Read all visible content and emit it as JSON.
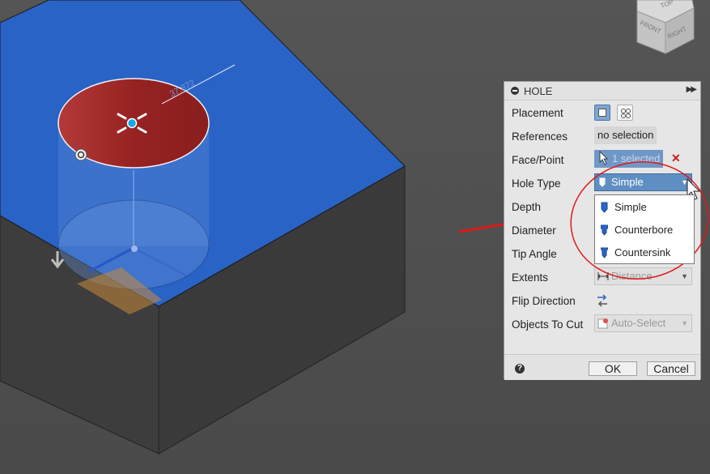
{
  "viewport": {
    "dimension_text": "37.872",
    "viewcube": {
      "top": "TOP",
      "front": "FRONT",
      "right": "RIGHT"
    }
  },
  "dialog": {
    "title": "HOLE",
    "rows": {
      "placement": {
        "label": "Placement"
      },
      "references": {
        "label": "References",
        "value": "no selection"
      },
      "face_point": {
        "label": "Face/Point",
        "value": "1 selected"
      },
      "hole_type": {
        "label": "Hole Type",
        "value": "Simple"
      },
      "depth": {
        "label": "Depth"
      },
      "diameter": {
        "label": "Diameter"
      },
      "tip_angle": {
        "label": "Tip Angle"
      },
      "extents": {
        "label": "Extents",
        "value": "Distance"
      },
      "flip_direction": {
        "label": "Flip Direction"
      },
      "objects_to_cut": {
        "label": "Objects To Cut",
        "value": "Auto-Select"
      }
    },
    "hole_type_options": [
      "Simple",
      "Counterbore",
      "Countersink"
    ],
    "ok_label": "OK",
    "cancel_label": "Cancel",
    "help_symbol": "?"
  },
  "colors": {
    "accent_blue": "#2a63c6",
    "hole_red": "#9c2626",
    "annotation_red": "#e01818"
  }
}
